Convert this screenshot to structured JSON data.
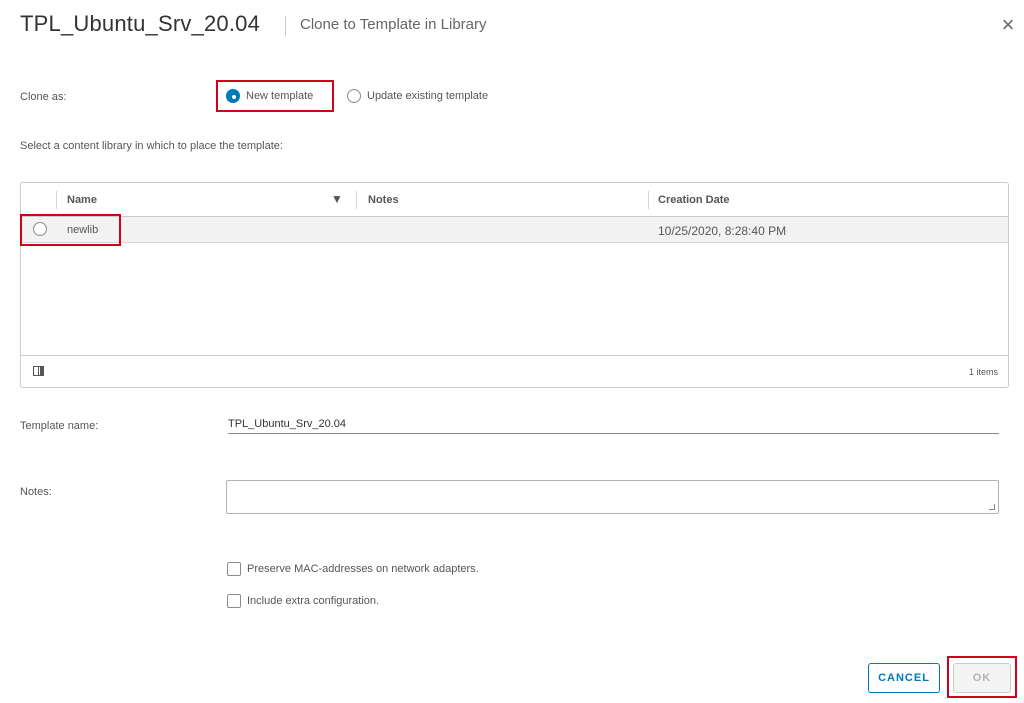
{
  "dialog": {
    "title": "TPL_Ubuntu_Srv_20.04",
    "subtitle": "Clone to Template in Library",
    "close_icon": "close-icon"
  },
  "clone_as": {
    "label": "Clone as:",
    "options": [
      {
        "label": "New template",
        "selected": true
      },
      {
        "label": "Update existing template",
        "selected": false
      }
    ]
  },
  "library": {
    "instruction": "Select a content library in which to place the template:",
    "columns": [
      "Name",
      "Notes",
      "Creation Date"
    ],
    "rows": [
      {
        "name": "newlib",
        "notes": "",
        "creation_date": "10/25/2020, 8:28:40 PM",
        "selected": false
      }
    ],
    "footer_count": "1 items",
    "column_toggle_icon": "column-toggle-icon",
    "filter_icon": "filter-icon"
  },
  "template_name": {
    "label": "Template name:",
    "value": "TPL_Ubuntu_Srv_20.04"
  },
  "notes": {
    "label": "Notes:",
    "value": ""
  },
  "options": [
    {
      "label": "Preserve MAC-addresses on network adapters.",
      "checked": false
    },
    {
      "label": "Include extra configuration.",
      "checked": false
    }
  ],
  "buttons": {
    "cancel": "CANCEL",
    "ok": "OK"
  },
  "colors": {
    "accent": "#0079b8",
    "highlight_box": "#d0021b"
  }
}
